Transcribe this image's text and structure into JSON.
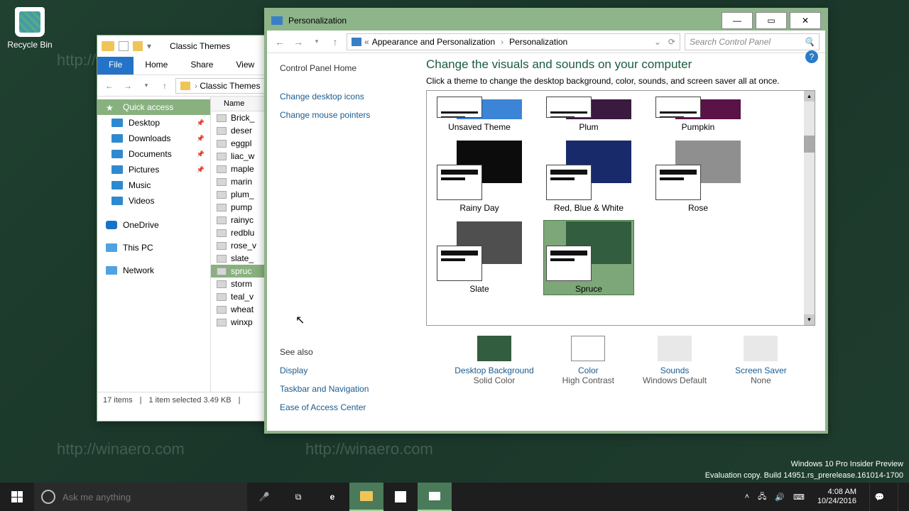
{
  "desktop": {
    "recycle_bin": "Recycle Bin"
  },
  "explorer": {
    "title": "Classic Themes",
    "ribbon": [
      "File",
      "Home",
      "Share",
      "View"
    ],
    "breadcrumb": "Classic Themes",
    "sidebar": [
      {
        "label": "Quick access",
        "pinned": false,
        "active": true
      },
      {
        "label": "Desktop",
        "pinned": true
      },
      {
        "label": "Downloads",
        "pinned": true
      },
      {
        "label": "Documents",
        "pinned": true
      },
      {
        "label": "Pictures",
        "pinned": true
      },
      {
        "label": "Music"
      },
      {
        "label": "Videos"
      },
      {
        "label": "OneDrive"
      },
      {
        "label": "This PC"
      },
      {
        "label": "Network"
      }
    ],
    "column": "Name",
    "files": [
      "Brick_",
      "deser",
      "eggpl",
      "liac_w",
      "maple",
      "marin",
      "plum_",
      "pump",
      "rainyc",
      "redblu",
      "rose_v",
      "slate_",
      "spruc",
      "storm",
      "teal_v",
      "wheat",
      "winxp"
    ],
    "selected_index": 12,
    "status": {
      "count": "17 items",
      "sel": "1 item selected  3.49 KB"
    }
  },
  "cp": {
    "title": "Personalization",
    "crumb1": "Appearance and Personalization",
    "crumb2": "Personalization",
    "search_placeholder": "Search Control Panel",
    "side": {
      "home": "Control Panel Home",
      "links": [
        "Change desktop icons",
        "Change mouse pointers"
      ],
      "see_also_hdr": "See also",
      "see_also": [
        "Display",
        "Taskbar and Navigation",
        "Ease of Access Center"
      ]
    },
    "heading": "Change the visuals and sounds on your computer",
    "sub": "Click a theme to change the desktop background, color, sounds, and screen saver all at once.",
    "themes_top": [
      {
        "name": "Unsaved Theme",
        "color": "#3c84d6"
      },
      {
        "name": "Plum",
        "color": "#3a1a3f"
      },
      {
        "name": "Pumpkin",
        "color": "#5a1247"
      }
    ],
    "themes_mid": [
      {
        "name": "Rainy Day",
        "color": "#0c0c0c"
      },
      {
        "name": "Red, Blue & White",
        "color": "#192a6a"
      },
      {
        "name": "Rose",
        "color": "#8f8f8f"
      }
    ],
    "themes_bot": [
      {
        "name": "Slate",
        "color": "#4f4f4f"
      },
      {
        "name": "Spruce",
        "color": "#325d3e",
        "selected": true
      }
    ],
    "settings": [
      {
        "title": "Desktop Background",
        "value": "Solid Color"
      },
      {
        "title": "Color",
        "value": "High Contrast"
      },
      {
        "title": "Sounds",
        "value": "Windows Default"
      },
      {
        "title": "Screen Saver",
        "value": "None"
      }
    ]
  },
  "sys": {
    "line1": "Windows 10 Pro Insider Preview",
    "line2": "Evaluation copy. Build 14951.rs_prerelease.161014-1700"
  },
  "taskbar": {
    "search_placeholder": "Ask me anything",
    "time": "4:08 AM",
    "date": "10/24/2016"
  }
}
